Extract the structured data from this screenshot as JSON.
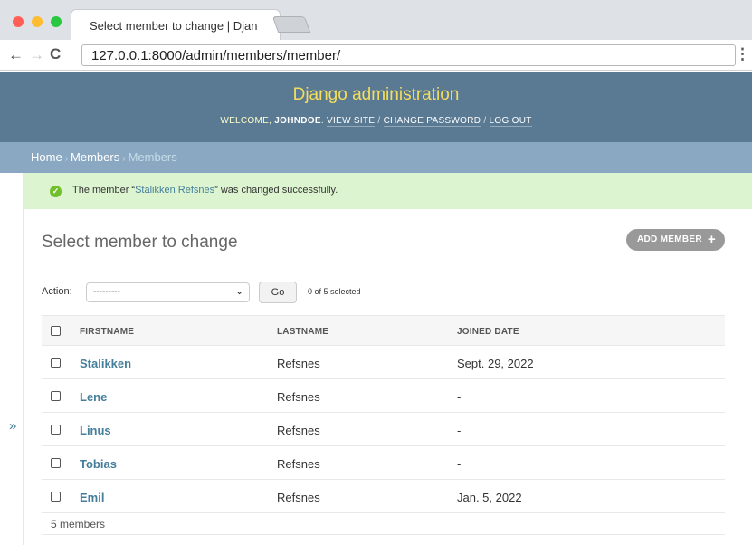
{
  "browser": {
    "tab_title": "Select member to change | Djan",
    "url": "127.0.0.1:8000/admin/members/member/"
  },
  "header": {
    "branding": "Django administration",
    "welcome": "WELCOME,",
    "username": "JOHNDOE",
    "view_site": "VIEW SITE",
    "change_password": "CHANGE PASSWORD",
    "log_out": "LOG OUT"
  },
  "breadcrumbs": {
    "home": "Home",
    "app": "Members",
    "current": "Members"
  },
  "message": {
    "prefix": "The member “",
    "object_link": "Stalikken Refsnes",
    "suffix": "” was changed successfully."
  },
  "content": {
    "title": "Select member to change",
    "add_button": "ADD MEMBER"
  },
  "actions": {
    "label": "Action:",
    "selected_option": "---------",
    "go_button": "Go",
    "counter": "0 of 5 selected"
  },
  "table": {
    "columns": [
      "FIRSTNAME",
      "LASTNAME",
      "JOINED DATE"
    ],
    "rows": [
      {
        "firstname": "Stalikken",
        "lastname": "Refsnes",
        "joined_date": "Sept. 29, 2022"
      },
      {
        "firstname": "Lene",
        "lastname": "Refsnes",
        "joined_date": "-"
      },
      {
        "firstname": "Linus",
        "lastname": "Refsnes",
        "joined_date": "-"
      },
      {
        "firstname": "Tobias",
        "lastname": "Refsnes",
        "joined_date": "-"
      },
      {
        "firstname": "Emil",
        "lastname": "Refsnes",
        "joined_date": "Jan. 5, 2022"
      }
    ],
    "paginator": "5 members"
  },
  "sidebar": {
    "toggle_glyph": "»"
  },
  "colors": {
    "header_bg": "#5a7a93",
    "branding": "#f5dd5d",
    "breadcrumbs_bg": "#8aa8c2",
    "success_bg": "#dcf5d0",
    "link": "#447e9b"
  },
  "icons": [
    "back-arrow-icon",
    "forward-arrow-icon",
    "reload-icon",
    "menu-dots-icon",
    "success-check-icon",
    "plus-icon",
    "chevron-down-icon",
    "sidebar-toggle-icon"
  ]
}
